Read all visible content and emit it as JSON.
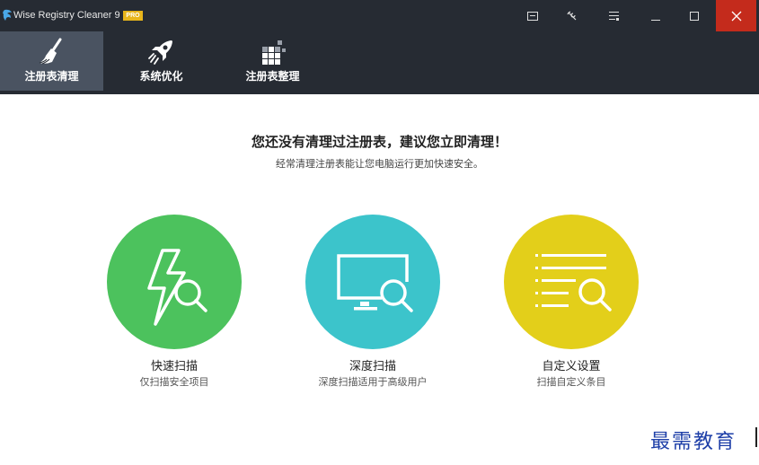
{
  "window": {
    "title": "Wise Registry Cleaner 9",
    "badge": "PRO",
    "controls": [
      "menu-icon",
      "tools-icon",
      "settings-list-icon",
      "minimize-icon",
      "maximize-icon",
      "close-icon"
    ],
    "close_color": "#c42b1c"
  },
  "toolbar": {
    "tabs": [
      {
        "label": "注册表清理",
        "icon": "broom-icon",
        "active": true
      },
      {
        "label": "系统优化",
        "icon": "rocket-icon",
        "active": false
      },
      {
        "label": "注册表整理",
        "icon": "defrag-icon",
        "active": false
      }
    ],
    "background": "#262b33",
    "active_background": "#4a5361"
  },
  "main": {
    "headline": "您还没有清理过注册表，建议您立即清理！",
    "subline": "经常清理注册表能让您电脑运行更加快速安全。",
    "options": [
      {
        "title": "快速扫描",
        "desc": "仅扫描安全项目",
        "color": "#4cc25d",
        "icon": "lightning-search-icon"
      },
      {
        "title": "深度扫描",
        "desc": "深度扫描适用于高级用户",
        "color": "#3cc4cb",
        "icon": "monitor-search-icon"
      },
      {
        "title": "自定义设置",
        "desc": "扫描自定义条目",
        "color": "#e3cf1a",
        "icon": "list-search-icon"
      }
    ]
  },
  "watermark": "最需教育"
}
